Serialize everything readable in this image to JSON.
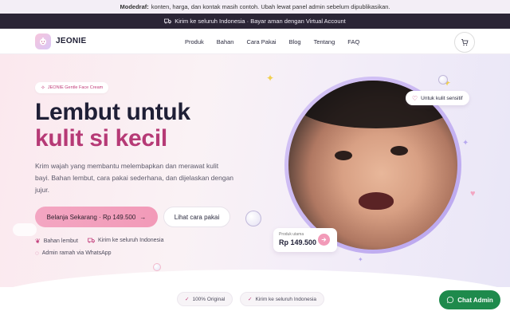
{
  "notice": {
    "prefix": "Modedraf:",
    "text": "konten, harga, dan kontak masih contoh. Ubah lewat panel admin sebelum dipublikasikan."
  },
  "shipping_bar": {
    "text": "Kirim ke seluruh Indonesia · Bayar aman dengan Virtual Account",
    "icon": "truck-icon"
  },
  "brand": {
    "name": "JEONIE"
  },
  "nav": {
    "items": [
      "Produk",
      "Bahan",
      "Cara Pakai",
      "Blog",
      "Tentang",
      "FAQ"
    ]
  },
  "hero": {
    "badge": "JEONIE Gentle Face Cream",
    "title_line1": "Lembut untuk",
    "title_line2": "kulit si kecil",
    "description": "Krim wajah yang membantu melembapkan dan merawat kulit bayi. Bahan lembut, cara pakai sederhana, dan dijelaskan dengan jujur.",
    "cta_primary": "Belanja Sekarang · Rp 149.500",
    "cta_secondary": "Lihat cara pakai",
    "features": [
      "Bahan lembut",
      "Kirim ke seluruh Indonesia",
      "Admin ramah via WhatsApp"
    ],
    "sensitive_chip": "Untuk kulit sensitif",
    "price_card": {
      "label": "Produk utama",
      "price": "Rp 149.500"
    }
  },
  "trust_chips": [
    "100% Original",
    "Kirim ke seluruh Indonesia"
  ],
  "chat_button": "Chat Admin",
  "colors": {
    "accent_pink": "#b63a76",
    "button_pink": "#f29ab8",
    "dark_bar": "#2b2536",
    "whatsapp_green": "#1e8a4c",
    "lavender": "#b8a4ee"
  }
}
